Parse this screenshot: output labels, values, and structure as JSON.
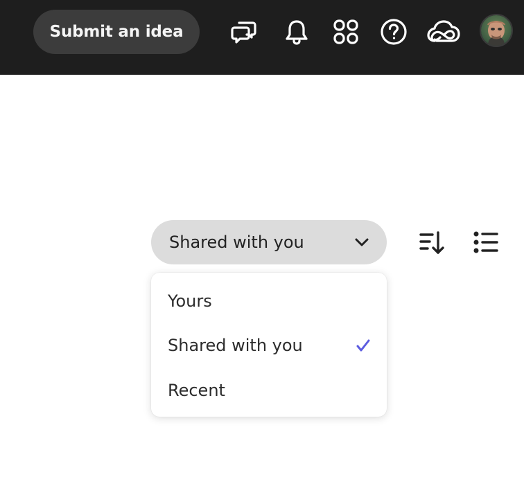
{
  "header": {
    "submit_label": "Submit an idea",
    "icons": [
      "chat-bubbles-icon",
      "bell-icon",
      "apps-grid-icon",
      "help-icon",
      "creative-cloud-icon"
    ],
    "avatar": "user-avatar"
  },
  "filter": {
    "selected": "Shared with you",
    "options": [
      {
        "label": "Yours",
        "checked": false
      },
      {
        "label": "Shared with you",
        "checked": true
      },
      {
        "label": "Recent",
        "checked": false
      }
    ]
  },
  "toolbar": {
    "icons": [
      "sort-icon",
      "list-view-icon"
    ]
  },
  "colors": {
    "topbar_bg": "#1e1e1e",
    "submit_bg": "#3c3c3c",
    "select_bg": "#dcdcdc",
    "check_color": "#5c5ce0"
  }
}
